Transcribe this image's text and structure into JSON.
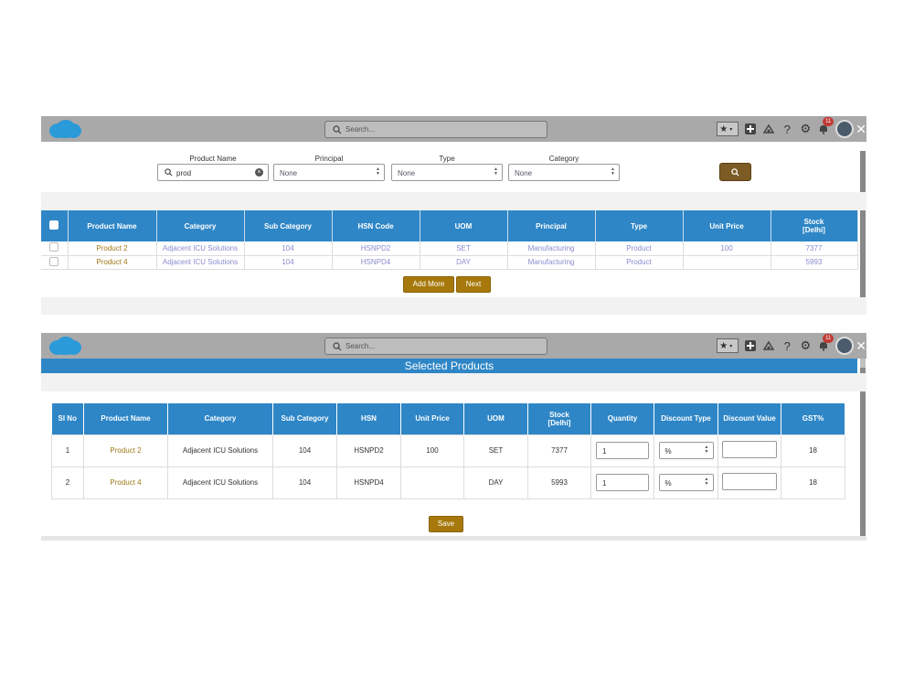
{
  "topbar": {
    "search_placeholder": "Search...",
    "notification_count": "11"
  },
  "filters": {
    "product_name_label": "Product Name",
    "product_name_value": "prod",
    "principal_label": "Principal",
    "principal_value": "None",
    "type_label": "Type",
    "type_value": "None",
    "category_label": "Category",
    "category_value": "None"
  },
  "results": {
    "columns": [
      "Product Name",
      "Category",
      "Sub Category",
      "HSN Code",
      "UOM",
      "Principal",
      "Type",
      "Unit Price"
    ],
    "stock_header_line1": "Stock",
    "stock_header_line2": "[Delhi]",
    "rows": [
      {
        "product_name": "Product 2",
        "category": "Adjacent ICU Solutions",
        "sub_category": "104",
        "hsn_code": "HSNPD2",
        "uom": "SET",
        "principal": "Manufacturing",
        "type": "Product",
        "unit_price": "100",
        "stock": "7377"
      },
      {
        "product_name": "Product 4",
        "category": "Adjacent ICU Solutions",
        "sub_category": "104",
        "hsn_code": "HSNPD4",
        "uom": "DAY",
        "principal": "Manufacturing",
        "type": "Product",
        "unit_price": "",
        "stock": "5993"
      }
    ],
    "add_more_label": "Add More",
    "next_label": "Next"
  },
  "selected": {
    "title": "Selected Products",
    "columns": [
      "Sl No",
      "Product Name",
      "Category",
      "Sub Category",
      "HSN",
      "Unit Price",
      "UOM"
    ],
    "stock_header_line1": "Stock",
    "stock_header_line2": "[Delhi]",
    "columns_after": [
      "Quantity",
      "Discount Type",
      "Discount Value",
      "GST%"
    ],
    "rows": [
      {
        "sl_no": "1",
        "product_name": "Product 2",
        "category": "Adjacent ICU Solutions",
        "sub_category": "104",
        "hsn": "HSNPD2",
        "unit_price": "100",
        "uom": "SET",
        "stock": "7377",
        "quantity": "1",
        "discount_type": "%",
        "discount_value": "",
        "gst": "18"
      },
      {
        "sl_no": "2",
        "product_name": "Product 4",
        "category": "Adjacent ICU Solutions",
        "sub_category": "104",
        "hsn": "HSNPD4",
        "unit_price": "",
        "uom": "DAY",
        "stock": "5993",
        "quantity": "1",
        "discount_type": "%",
        "discount_value": "",
        "gst": "18"
      }
    ],
    "save_label": "Save"
  },
  "colors": {
    "header_blue": "#2e86c6",
    "gold_button": "#a7790c",
    "topbar_grey": "#a9a9a9"
  }
}
